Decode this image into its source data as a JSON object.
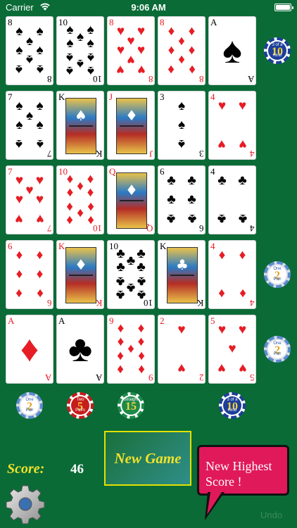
{
  "status": {
    "carrier": "Carrier",
    "time": "9:06 AM"
  },
  "cards": [
    [
      {
        "rank": "8",
        "suit": "spade"
      },
      {
        "rank": "10",
        "suit": "spade"
      },
      {
        "rank": "8",
        "suit": "heart"
      },
      {
        "rank": "8",
        "suit": "diamond"
      },
      {
        "rank": "A",
        "suit": "spade"
      }
    ],
    [
      {
        "rank": "7",
        "suit": "spade"
      },
      {
        "rank": "K",
        "suit": "spade"
      },
      {
        "rank": "J",
        "suit": "diamond"
      },
      {
        "rank": "3",
        "suit": "spade"
      },
      {
        "rank": "4",
        "suit": "heart"
      }
    ],
    [
      {
        "rank": "7",
        "suit": "heart"
      },
      {
        "rank": "10",
        "suit": "diamond"
      },
      {
        "rank": "Q",
        "suit": "diamond"
      },
      {
        "rank": "6",
        "suit": "club"
      },
      {
        "rank": "4",
        "suit": "club"
      }
    ],
    [
      {
        "rank": "6",
        "suit": "diamond"
      },
      {
        "rank": "K",
        "suit": "diamond"
      },
      {
        "rank": "10",
        "suit": "club"
      },
      {
        "rank": "K",
        "suit": "club"
      },
      {
        "rank": "4",
        "suit": "diamond"
      }
    ],
    [
      {
        "rank": "A",
        "suit": "diamond"
      },
      {
        "rank": "A",
        "suit": "club"
      },
      {
        "rank": "9",
        "suit": "diamond"
      },
      {
        "rank": "2",
        "suit": "heart"
      },
      {
        "rank": "5",
        "suit": "heart"
      }
    ]
  ],
  "row_chips": [
    {
      "row": 0,
      "top": "3 of a",
      "num": "10",
      "bottom": "Kind",
      "style": "blue"
    },
    {
      "row": 3,
      "top": "One",
      "num": "2",
      "bottom": "Pair",
      "style": "white"
    },
    {
      "row": 4,
      "top": "One",
      "num": "2",
      "bottom": "Pair",
      "style": "white"
    }
  ],
  "column_chips": [
    {
      "col": 0,
      "top": "One",
      "num": "2",
      "bottom": "Pair",
      "style": "white"
    },
    {
      "col": 1,
      "top": "Two",
      "num": "5",
      "bottom": "Pairs",
      "style": "red"
    },
    {
      "col": 2,
      "top": "Straight",
      "num": "15",
      "bottom": "",
      "style": "green"
    },
    {
      "col": 4,
      "top": "3 of a",
      "num": "10",
      "bottom": "Kind",
      "style": "blue"
    }
  ],
  "score": {
    "label": "Score:",
    "value": "46"
  },
  "buttons": {
    "new_game": "New Game",
    "undo": "Undo"
  },
  "highscore": {
    "line1": "New Highest",
    "line2": "Score !"
  },
  "suit_symbols": {
    "spade": "♠",
    "heart": "♥",
    "diamond": "♦",
    "club": "♣"
  },
  "suit_colors": {
    "red": "#e61d25",
    "black": "#000000"
  },
  "table_color": "#0a6b37"
}
